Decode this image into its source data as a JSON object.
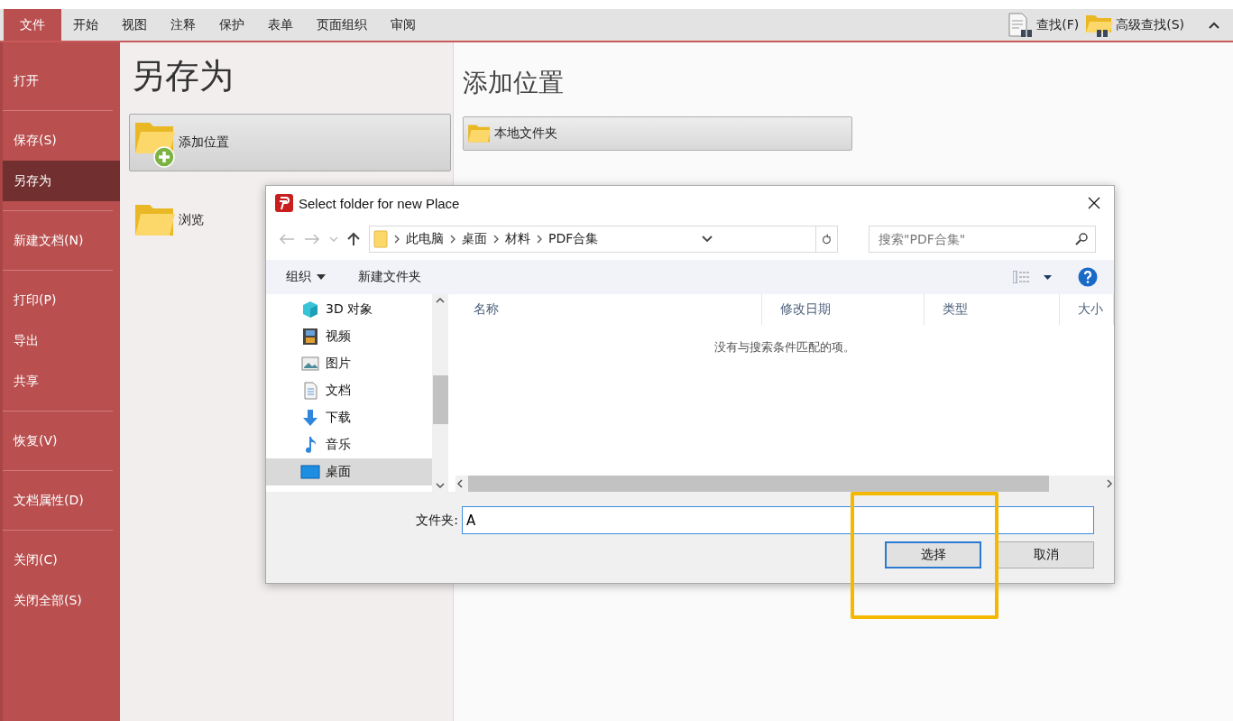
{
  "ribbon": {
    "tabs": [
      {
        "label": "文件",
        "selected": true
      },
      {
        "label": "开始",
        "selected": false
      },
      {
        "label": "视图",
        "selected": false
      },
      {
        "label": "注释",
        "selected": false
      },
      {
        "label": "保护",
        "selected": false
      },
      {
        "label": "表单",
        "selected": false
      },
      {
        "label": "页面组织",
        "selected": false
      },
      {
        "label": "审阅",
        "selected": false
      }
    ],
    "actions": [
      {
        "label": "查找(F)",
        "kind": "find"
      },
      {
        "label": "高级查找(S)",
        "kind": "advanced"
      }
    ]
  },
  "sidebar": {
    "groups": [
      {
        "items": [
          {
            "label": "打开",
            "selected": false
          }
        ]
      },
      {
        "items": [
          {
            "label": "保存(S)",
            "selected": false
          },
          {
            "label": "另存为",
            "selected": true
          }
        ]
      },
      {
        "items": [
          {
            "label": "新建文档(N)",
            "selected": false
          }
        ]
      },
      {
        "items": [
          {
            "label": "打印(P)",
            "selected": false
          },
          {
            "label": "导出",
            "selected": false
          },
          {
            "label": "共享",
            "selected": false
          }
        ]
      },
      {
        "items": [
          {
            "label": "恢复(V)",
            "selected": false
          }
        ]
      },
      {
        "items": [
          {
            "label": "文档属性(D)",
            "selected": false
          }
        ]
      },
      {
        "items": [
          {
            "label": "关闭(C)",
            "selected": false
          },
          {
            "label": "关闭全部(S)",
            "selected": false
          }
        ]
      }
    ]
  },
  "save_as": {
    "title": "另存为",
    "options": [
      {
        "label": "添加位置",
        "kind": "add",
        "selected": true
      },
      {
        "label": "浏览",
        "kind": "browse",
        "selected": false
      }
    ]
  },
  "add_place": {
    "title": "添加位置",
    "buttons": [
      {
        "label": "本地文件夹"
      }
    ]
  },
  "dialog": {
    "title": "Select folder for new Place",
    "path": [
      "此电脑",
      "桌面",
      "材料",
      "PDF合集"
    ],
    "search": {
      "placeholder": "搜索\"PDF合集\""
    },
    "toolbar": {
      "organize": "组织",
      "new_folder": "新建文件夹"
    },
    "tree": [
      {
        "label": "3D 对象",
        "kind": "cube",
        "selected": false
      },
      {
        "label": "视频",
        "kind": "video",
        "selected": false
      },
      {
        "label": "图片",
        "kind": "picture",
        "selected": false
      },
      {
        "label": "文档",
        "kind": "document",
        "selected": false
      },
      {
        "label": "下载",
        "kind": "download",
        "selected": false
      },
      {
        "label": "音乐",
        "kind": "music",
        "selected": false
      },
      {
        "label": "桌面",
        "kind": "desktop",
        "selected": true
      }
    ],
    "columns": [
      "名称",
      "修改日期",
      "类型",
      "大小"
    ],
    "empty_message": "没有与搜索条件匹配的项。",
    "folder_label": "文件夹:",
    "folder_value": "A",
    "buttons": [
      {
        "label": "选择",
        "kind": "primary"
      },
      {
        "label": "取消",
        "kind": "normal"
      }
    ]
  },
  "highlight": {
    "on": true
  }
}
